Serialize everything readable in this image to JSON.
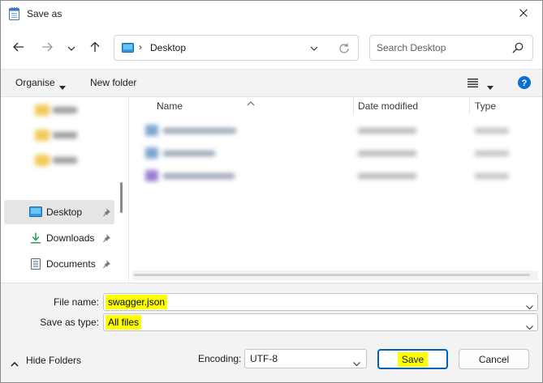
{
  "window": {
    "title": "Save as"
  },
  "navigation": {
    "back_icon": "arrow-left-icon",
    "forward_icon": "arrow-right-icon",
    "recent_icon": "chevron-down-icon",
    "up_icon": "arrow-up-icon",
    "address": {
      "location_icon": "desktop-icon",
      "separator": "›",
      "path": "Desktop"
    },
    "search": {
      "placeholder": "Search Desktop"
    }
  },
  "command_bar": {
    "organise_label": "Organise",
    "new_folder_label": "New folder",
    "view_icon": "list-view-icon",
    "help_icon": "help-icon",
    "help_glyph": "?"
  },
  "sidebar": {
    "quick_access": [
      {
        "label": "Desktop",
        "icon": "desktop-icon",
        "pinned": true,
        "selected": true
      },
      {
        "label": "Downloads",
        "icon": "download-icon",
        "pinned": true,
        "selected": false
      },
      {
        "label": "Documents",
        "icon": "documents-icon",
        "pinned": true,
        "selected": false
      }
    ]
  },
  "file_list": {
    "columns": [
      "Name",
      "Date modified",
      "Type"
    ],
    "sort_column": "Name"
  },
  "form": {
    "file_name_label": "File name:",
    "file_name_value": "swagger.json",
    "save_as_type_label": "Save as type:",
    "save_as_type_value": "All files",
    "encoding_label": "Encoding:",
    "encoding_value": "UTF-8",
    "hide_folders_label": "Hide Folders",
    "save_label": "Save",
    "cancel_label": "Cancel"
  },
  "colors": {
    "accent": "#005fb8",
    "highlight": "#ffff00",
    "selection": "#e5e5e5"
  }
}
